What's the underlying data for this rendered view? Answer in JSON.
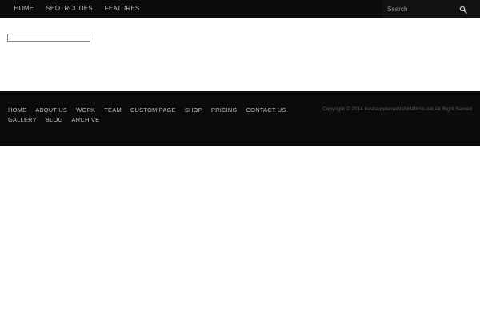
{
  "topnav": {
    "items": [
      {
        "label": "HOME"
      },
      {
        "label": "SHOTRCODES"
      },
      {
        "label": "FEATURES"
      }
    ]
  },
  "search": {
    "placeholder": "Search",
    "icon": "search-icon"
  },
  "footer": {
    "nav": [
      {
        "label": "HOME"
      },
      {
        "label": "ABOUT US"
      },
      {
        "label": "WORK"
      },
      {
        "label": "TEAM"
      },
      {
        "label": "CUSTOM PAGE"
      },
      {
        "label": "SHOP"
      },
      {
        "label": "PRICING"
      },
      {
        "label": "CONTACT US"
      },
      {
        "label": "GALLERY"
      },
      {
        "label": "BLOG"
      },
      {
        "label": "ARCHIVE"
      }
    ],
    "copyright": "Copyright © 2014 bestsupplementsforfatloss.net All Right Served"
  },
  "colors": {
    "bar_background": "#0b0b0b",
    "nav_text": "#bdbdbd",
    "copyright_text": "#5c5c5c"
  }
}
